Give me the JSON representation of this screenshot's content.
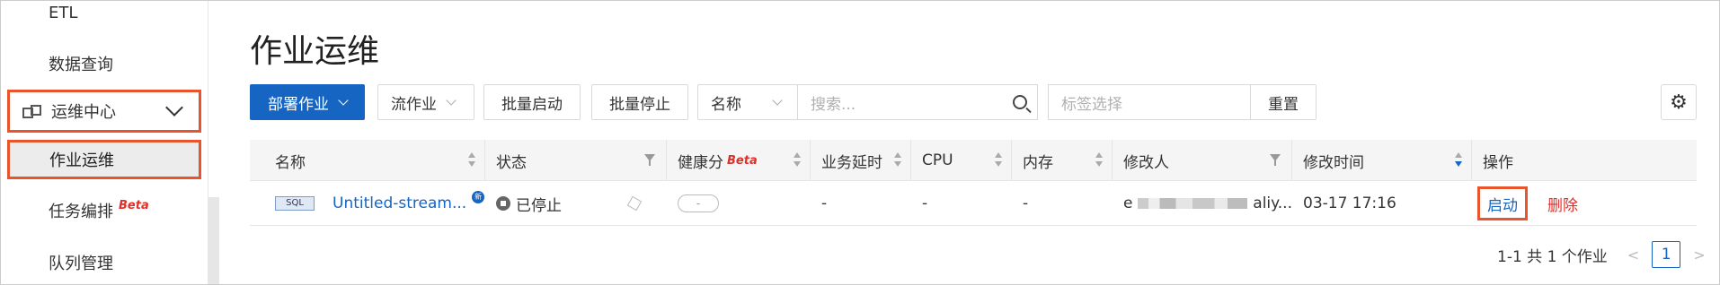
{
  "sidebar": {
    "items": [
      {
        "label": "ETL"
      },
      {
        "label": "数据查询"
      },
      {
        "label": "运维中心"
      },
      {
        "label": "作业运维"
      },
      {
        "label": "任务编排",
        "badge": "Beta"
      },
      {
        "label": "队列管理"
      }
    ]
  },
  "page": {
    "title": "作业运维"
  },
  "toolbar": {
    "deploy_label": "部署作业",
    "job_type": "流作业",
    "batch_start": "批量启动",
    "batch_stop": "批量停止",
    "field_select": "名称",
    "search_placeholder": "搜索...",
    "tag_placeholder": "标签选择",
    "reset_label": "重置"
  },
  "table": {
    "columns": [
      {
        "label": "名称"
      },
      {
        "label": "状态"
      },
      {
        "label": "健康分",
        "badge": "Beta"
      },
      {
        "label": "业务延时"
      },
      {
        "label": "CPU"
      },
      {
        "label": "内存"
      },
      {
        "label": "修改人"
      },
      {
        "label": "修改时间"
      },
      {
        "label": "操作"
      }
    ],
    "rows": [
      {
        "type_tag": "SQL",
        "name": "Untitled-stream...",
        "new_badge": "新",
        "status": "已停止",
        "health": "-",
        "delay": "-",
        "cpu": "-",
        "memory": "-",
        "modifier_prefix": "e",
        "modifier_suffix": "aliy...",
        "modified_time": "03-17 17:16",
        "op_start": "启动",
        "op_delete": "删除"
      }
    ]
  },
  "pagination": {
    "summary": "1-1 共 1 个作业",
    "current_page": "1"
  },
  "colors": {
    "primary": "#1665c2",
    "danger": "#e0302c",
    "highlight": "#e8552d"
  }
}
